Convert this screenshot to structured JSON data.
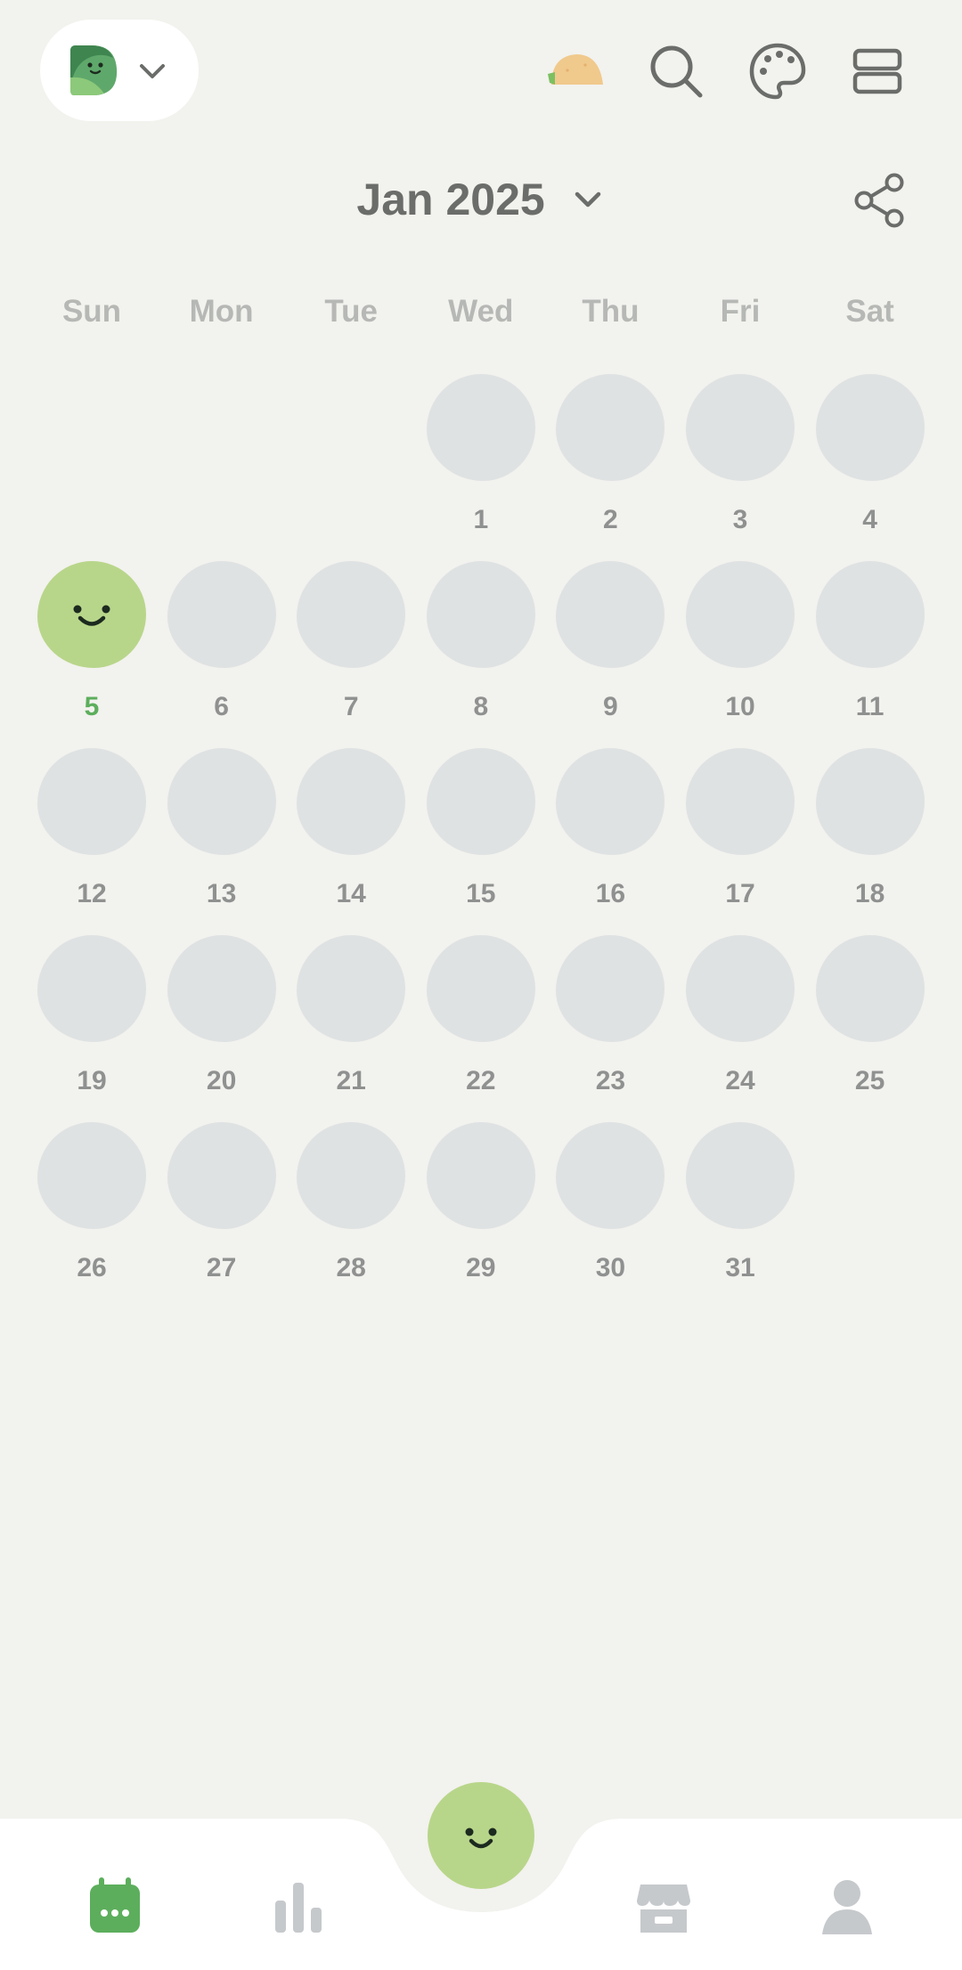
{
  "header": {
    "journal_switch_icon": "leaf-avatar-icon",
    "icons": [
      "taco-icon",
      "search-icon",
      "palette-icon",
      "layout-icon"
    ]
  },
  "calendar": {
    "month_label": "Jan 2025",
    "weekdays": [
      "Sun",
      "Mon",
      "Tue",
      "Wed",
      "Thu",
      "Fri",
      "Sat"
    ],
    "first_weekday_index": 3,
    "days_in_month": 31,
    "today": 5,
    "logged_days": [
      5
    ]
  },
  "colors": {
    "background": "#f2f2ee",
    "empty_day": "#dfe2e3",
    "mood_green": "#b8d68a",
    "accent_green": "#5cae5c",
    "muted_text": "#8f9190"
  },
  "bottom_nav": {
    "items": [
      "calendar-icon",
      "stats-icon",
      "add-mood-icon",
      "store-icon",
      "profile-icon"
    ],
    "active": "calendar-icon"
  }
}
